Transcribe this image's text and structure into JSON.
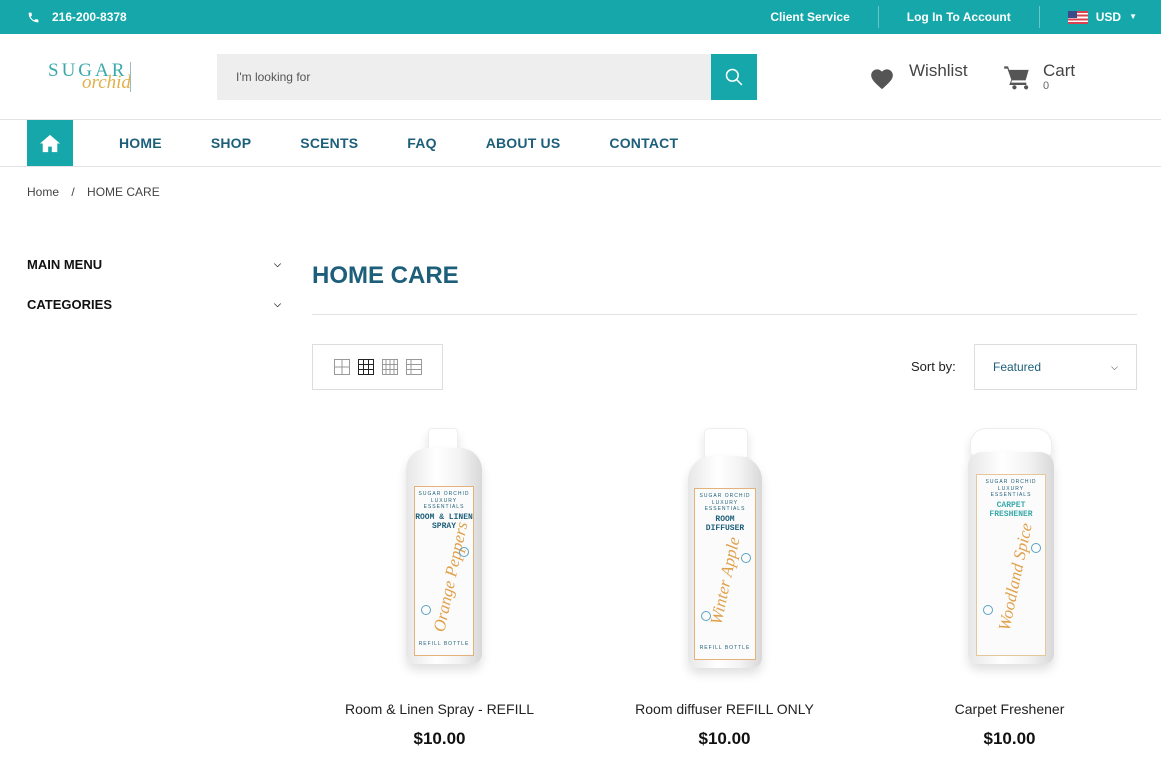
{
  "topbar": {
    "phone": "216-200-8378",
    "client_service": "Client Service",
    "login": "Log In To Account",
    "currency": "USD"
  },
  "logo": {
    "text": "SUGAR",
    "script": "orchid"
  },
  "search": {
    "placeholder": "I'm looking for"
  },
  "header": {
    "wishlist": "Wishlist",
    "cart": "Cart",
    "cart_count": "0"
  },
  "nav": {
    "items": [
      "HOME",
      "SHOP",
      "SCENTS",
      "FAQ",
      "ABOUT US",
      "CONTACT"
    ]
  },
  "breadcrumb": {
    "home": "Home",
    "sep": "/",
    "current": "HOME CARE"
  },
  "sidebar": {
    "main_menu": "MAIN MENU",
    "categories": "CATEGORIES"
  },
  "page": {
    "title": "HOME CARE"
  },
  "sort": {
    "label": "Sort by:",
    "value": "Featured"
  },
  "products": [
    {
      "name": "Room & Linen Spray - REFILL",
      "price": "$10.00",
      "label": {
        "brand": "SUGAR ORCHID",
        "sub": "LUXURY ESSENTIALS",
        "kind": "ROOM & LINEN SPRAY",
        "scent": "Orange Peppers",
        "foot": "REFILL BOTTLE"
      }
    },
    {
      "name": "Room diffuser REFILL ONLY",
      "price": "$10.00",
      "label": {
        "brand": "SUGAR ORCHID",
        "sub": "LUXURY ESSENTIALS",
        "kind": "ROOM DIFFUSER",
        "scent": "Winter Apple",
        "foot": "REFILL BOTTLE"
      }
    },
    {
      "name": "Carpet Freshener",
      "price": "$10.00",
      "label": {
        "brand": "SUGAR ORCHID",
        "sub": "LUXURY ESSENTIALS",
        "kind": "CARPET FRESHENER",
        "scent": "Woodland Spice",
        "foot": ""
      }
    }
  ],
  "colors": {
    "accent": "#15a7a9",
    "nav_text": "#1d5f7a"
  },
  "icons": [
    "phone-icon",
    "flag-icon",
    "search-icon",
    "heart-icon",
    "cart-icon",
    "home-icon",
    "grid-icon"
  ]
}
